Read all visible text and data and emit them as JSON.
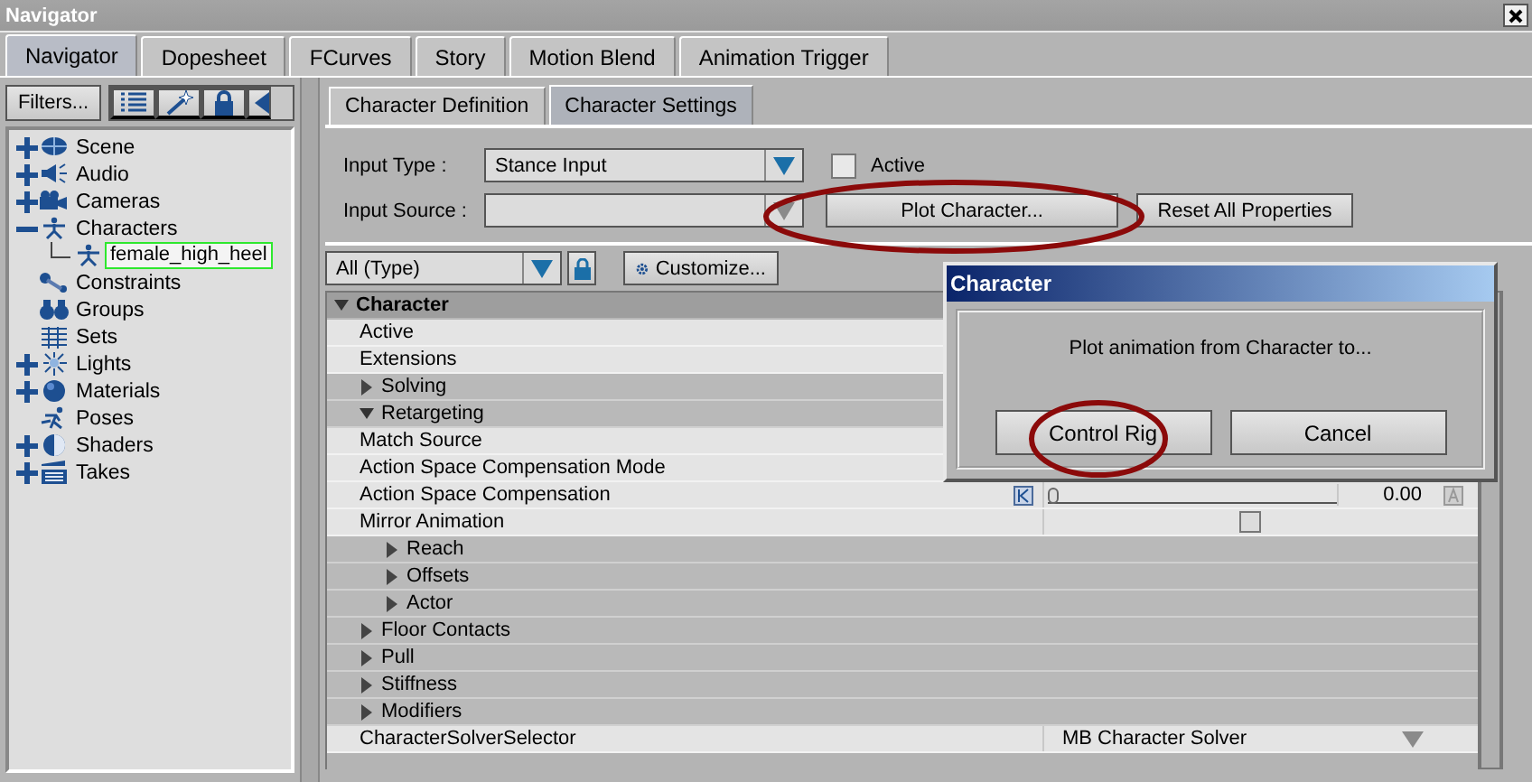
{
  "window": {
    "title": "Navigator"
  },
  "tabs": [
    {
      "label": "Navigator",
      "selected": true
    },
    {
      "label": "Dopesheet",
      "selected": false
    },
    {
      "label": "FCurves",
      "selected": false
    },
    {
      "label": "Story",
      "selected": false
    },
    {
      "label": "Motion Blend",
      "selected": false
    },
    {
      "label": "Animation Trigger",
      "selected": false
    }
  ],
  "navigator": {
    "filter_button": "Filters...",
    "tree": [
      {
        "label": "Scene",
        "expanded": false
      },
      {
        "label": "Audio",
        "expanded": false
      },
      {
        "label": "Cameras",
        "expanded": false
      },
      {
        "label": "Characters",
        "expanded": true,
        "children": [
          {
            "label": "female_high_heel",
            "selected": true
          }
        ]
      },
      {
        "label": "Constraints"
      },
      {
        "label": "Groups"
      },
      {
        "label": "Sets"
      },
      {
        "label": "Lights",
        "expanded": false
      },
      {
        "label": "Materials",
        "expanded": false
      },
      {
        "label": "Poses"
      },
      {
        "label": "Shaders",
        "expanded": false
      },
      {
        "label": "Takes",
        "expanded": false
      }
    ]
  },
  "character_panel": {
    "tabs": [
      {
        "label": "Character Definition",
        "selected": false
      },
      {
        "label": "Character Settings",
        "selected": true
      }
    ],
    "input_type": {
      "label": "Input Type :",
      "value": "Stance Input"
    },
    "active": {
      "label": "Active",
      "checked": false
    },
    "input_source": {
      "label": "Input Source :"
    },
    "buttons": [
      "Plot Character...",
      "Reset All Properties"
    ],
    "filter": {
      "value": "All (Type)"
    },
    "customize_button": "Customize...",
    "properties": [
      {
        "kind": "group",
        "label": "Character",
        "expanded": true,
        "children": [
          {
            "kind": "property",
            "label": "Active"
          },
          {
            "kind": "property",
            "label": "Extensions"
          },
          {
            "kind": "folder",
            "label": "Solving",
            "expanded": false
          },
          {
            "kind": "folder",
            "label": "Retargeting",
            "expanded": true,
            "children": [
              {
                "kind": "property",
                "label": "Match Source"
              },
              {
                "kind": "property",
                "label": "Action Space Compensation Mode"
              },
              {
                "kind": "property",
                "label": "Action Space Compensation",
                "value": {
                  "kind": "number",
                  "text": "0.00",
                  "level": 0
                }
              },
              {
                "kind": "property",
                "label": "Mirror Animation",
                "value": {
                  "kind": "checkbox",
                  "checked": false
                }
              },
              {
                "kind": "folder",
                "label": "Reach",
                "expanded": false
              },
              {
                "kind": "folder",
                "label": "Offsets",
                "expanded": false
              },
              {
                "kind": "folder",
                "label": "Actor",
                "expanded": false
              }
            ]
          },
          {
            "kind": "folder",
            "label": "Floor Contacts",
            "expanded": false
          },
          {
            "kind": "folder",
            "label": "Pull",
            "expanded": false
          },
          {
            "kind": "folder",
            "label": "Stiffness",
            "expanded": false
          },
          {
            "kind": "folder",
            "label": "Modifiers",
            "expanded": false
          },
          {
            "kind": "property",
            "label": "CharacterSolverSelector",
            "value": {
              "kind": "dropdown",
              "text": "MB Character Solver"
            }
          }
        ]
      }
    ]
  },
  "dialog": {
    "title": "Character",
    "message": "Plot animation from Character to...",
    "buttons": [
      "Control Rig",
      "Cancel"
    ]
  }
}
